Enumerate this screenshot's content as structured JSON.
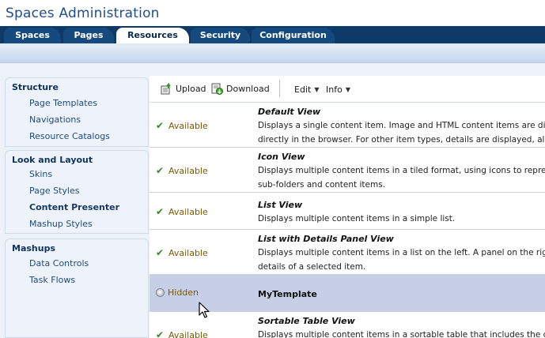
{
  "app": {
    "title": "Spaces Administration"
  },
  "tabs": [
    {
      "label": "Spaces"
    },
    {
      "label": "Pages"
    },
    {
      "label": "Resources"
    },
    {
      "label": "Security"
    },
    {
      "label": "Configuration"
    }
  ],
  "sidebar": {
    "sections": [
      {
        "title": "Structure",
        "items": [
          "Page Templates",
          "Navigations",
          "Resource Catalogs"
        ]
      },
      {
        "title": "Look and Layout",
        "items": [
          "Skins",
          "Page Styles",
          "Content Presenter",
          "Mashup Styles"
        ]
      },
      {
        "title": "Mashups",
        "items": [
          "Data Controls",
          "Task Flows"
        ]
      }
    ]
  },
  "toolbar": {
    "upload": "Upload",
    "download": "Download",
    "edit": "Edit",
    "info": "Info"
  },
  "rows": [
    {
      "status": "Available",
      "name": "Default View",
      "desc1": "Displays a single content item. Image and HTML content items are displayed",
      "desc2": "directly in the browser. For other item types, details are displayed, along..."
    },
    {
      "status": "Available",
      "name": "Icon View",
      "desc1": "Displays multiple content items in a tiled format, using icons to represent",
      "desc2": "sub-folders and content items."
    },
    {
      "status": "Available",
      "name": "List View",
      "desc1": "Displays multiple content items in a simple list."
    },
    {
      "status": "Available",
      "name": "List with Details Panel View",
      "desc1": "Displays multiple content items in a list on the left. A panel on the right displays",
      "desc2": "details of a selected item."
    },
    {
      "status": "Hidden",
      "name": "MyTemplate"
    },
    {
      "status": "Available",
      "name": "Sortable Table View",
      "desc1": "Displays multiple content items in a sortable table that includes the document"
    }
  ],
  "colors": {
    "tabbar": "#0d3a66",
    "accent": "#1f4e8c",
    "selected_row": "#c7cfe6",
    "available": "#2e8a1e"
  }
}
